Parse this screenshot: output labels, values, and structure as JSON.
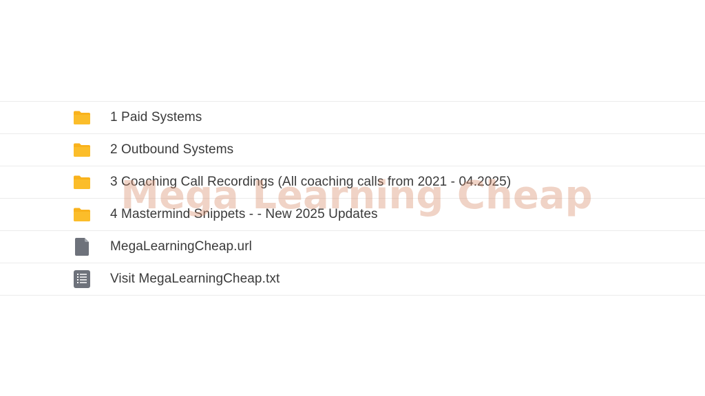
{
  "files": [
    {
      "name": "1 Paid Systems",
      "icon": "folder-icon"
    },
    {
      "name": "2 Outbound Systems",
      "icon": "folder-icon"
    },
    {
      "name": "3 Coaching Call Recordings (All coaching calls from 2021 - 04.2025)",
      "icon": "folder-icon"
    },
    {
      "name": "4 Mastermind Snippets - - New 2025 Updates",
      "icon": "folder-icon"
    },
    {
      "name": "MegaLearningCheap.url",
      "icon": "file-icon"
    },
    {
      "name": "Visit MegaLearningCheap.txt",
      "icon": "text-document-icon"
    }
  ],
  "watermark": "Mega Learning Cheap",
  "colors": {
    "folder": "#f9b21c",
    "document": "#6e727b",
    "row_divider": "#ebebeb",
    "text": "#3a3a3a",
    "watermark": "#d78c69"
  }
}
